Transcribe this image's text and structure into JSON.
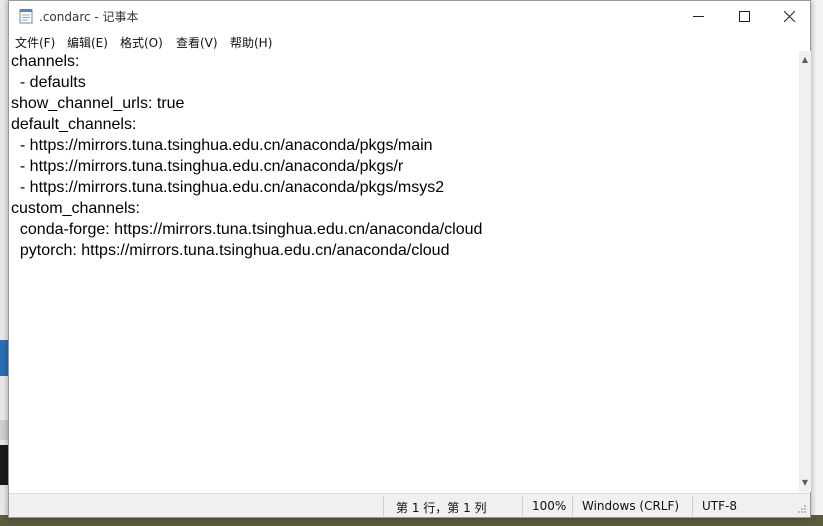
{
  "window": {
    "title": ".condarc - 记事本"
  },
  "menu": [
    "文件(F)",
    "编辑(E)",
    "格式(O)",
    "查看(V)",
    "帮助(H)"
  ],
  "editor": {
    "lines": [
      "channels:",
      "  - defaults",
      "show_channel_urls: true",
      "default_channels:",
      "  - https://mirrors.tuna.tsinghua.edu.cn/anaconda/pkgs/main",
      "  - https://mirrors.tuna.tsinghua.edu.cn/anaconda/pkgs/r",
      "  - https://mirrors.tuna.tsinghua.edu.cn/anaconda/pkgs/msys2",
      "custom_channels:",
      "  conda-forge: https://mirrors.tuna.tsinghua.edu.cn/anaconda/cloud",
      "  pytorch: https://mirrors.tuna.tsinghua.edu.cn/anaconda/cloud"
    ]
  },
  "status": {
    "position": "第 1 行，第 1 列",
    "zoom": "100%",
    "line_ending": "Windows (CRLF)",
    "encoding": "UTF-8"
  }
}
